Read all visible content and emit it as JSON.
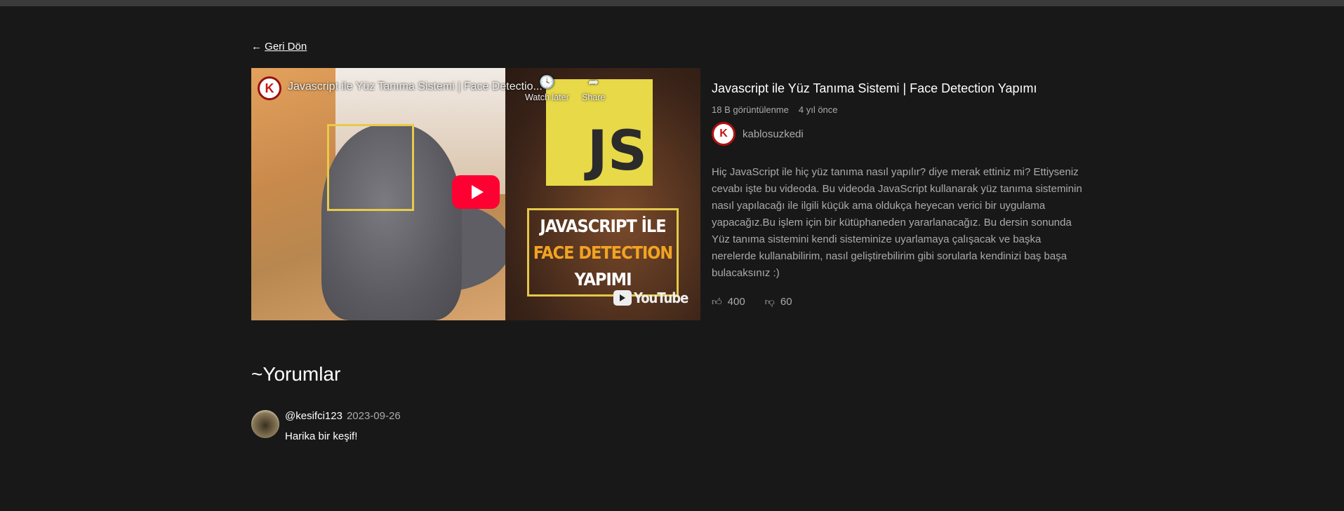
{
  "nav": {
    "back_arrow": "←",
    "back_label": "Geri Dön"
  },
  "player": {
    "channel_logo": "K",
    "title": "Javascript ile Yüz Tanıma Sistemi | Face Detectio...",
    "watch_later_icon": "clock-icon",
    "watch_later": "Watch later",
    "share_icon": "share-icon",
    "share": "Share",
    "thumb_js": "JS",
    "thumb_line1": "JAVASCRIPT İLE",
    "thumb_line2": "FACE DETECTION",
    "thumb_line3": "YAPIMI",
    "youtube_logo": "YouTube"
  },
  "video": {
    "title": "Javascript ile Yüz Tanıma Sistemi | Face Detection Yapımı",
    "views": "18 B görüntülenme",
    "age": "4 yıl önce",
    "channel_logo": "K",
    "channel": "kablosuzkedi",
    "description": "Hiç JavaScript ile hiç yüz tanıma nasıl yapılır? diye merak ettiniz mi? Ettiyseniz cevabı işte bu videoda. Bu videoda JavaScript kullanarak yüz tanıma sisteminin nasıl yapılacağı ile ilgili küçük ama oldukça heyecan verici bir uygulama yapacağız.Bu işlem için bir kütüphaneden yararlanacağız. Bu dersin sonunda Yüz tanıma sistemini kendi sisteminize uyarlamaya çalışacak ve başka nerelerde kullanabilirim, nasıl geliştirebilirim gibi sorularla kendinizi baş başa bulacaksınız :)",
    "likes": "400",
    "dislikes": "60"
  },
  "comments": {
    "heading": "~Yorumlar",
    "items": [
      {
        "user": "@kesifci123",
        "date": "2023-09-26",
        "text": "Harika bir keşif!"
      }
    ]
  }
}
